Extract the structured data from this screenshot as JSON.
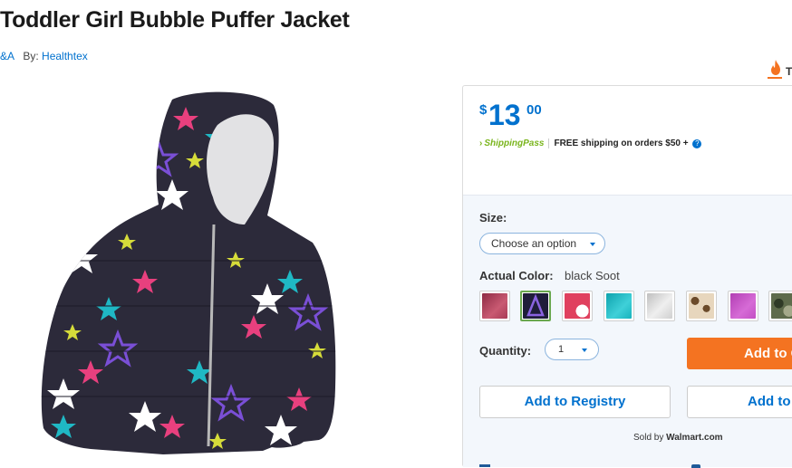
{
  "product": {
    "title": "Toddler Girl Bubble Puffer Jacket",
    "qa_link": "&A",
    "by_label": "By:",
    "brand": "Healthtex"
  },
  "badge": {
    "text": "T",
    "icon": "flame-icon"
  },
  "price": {
    "currency": "$",
    "dollars": "13",
    "cents": "00"
  },
  "shipping": {
    "pass_label": "ShippingPass",
    "text": "FREE shipping on orders $50 +",
    "help_icon": "?"
  },
  "size": {
    "label": "Size:",
    "placeholder": "Choose an option"
  },
  "color": {
    "label": "Actual Color:",
    "selected": "black Soot",
    "swatches": [
      {
        "name": "swatch-berry",
        "color": "#a83a55"
      },
      {
        "name": "swatch-black-soot",
        "color": "#1f1d3a",
        "selected": true
      },
      {
        "name": "swatch-pink",
        "color": "#e0405e"
      },
      {
        "name": "swatch-teal",
        "color": "#17b3bd"
      },
      {
        "name": "swatch-silver",
        "color": "#cfcfcf"
      },
      {
        "name": "swatch-leopard",
        "color": "#d8c3a6"
      },
      {
        "name": "swatch-magenta",
        "color": "#c34fc4"
      },
      {
        "name": "swatch-camo",
        "color": "#5e6b4b"
      }
    ]
  },
  "quantity": {
    "label": "Quantity:",
    "value": "1"
  },
  "actions": {
    "add_to_cart": "Add to Cart",
    "add_to_registry": "Add to Registry",
    "add_to_list": "Add to List"
  },
  "seller": {
    "sold_by": "Sold by",
    "name": "Walmart.com"
  },
  "colors": {
    "accent": "#0071ce",
    "cart": "#f47321",
    "selected_border": "#6aa84f",
    "shipping_pass": "#7ab51d"
  }
}
